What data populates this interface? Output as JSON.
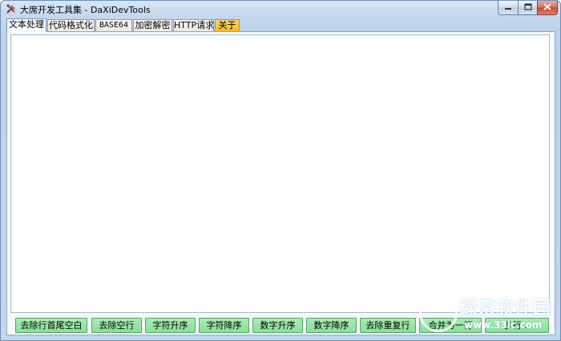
{
  "window": {
    "title": "大席开发工具集 - DaXiDevTools",
    "icon": "tools-icon",
    "controls": {
      "minimize": "minimize-icon",
      "maximize": "maximize-icon",
      "close": "close-icon"
    }
  },
  "tabs": [
    {
      "label": "文本处理",
      "active": true
    },
    {
      "label": "代码格式化",
      "active": false
    },
    {
      "label": "BASE64",
      "active": false
    },
    {
      "label": "加密解密",
      "active": false
    },
    {
      "label": "HTTP请求",
      "active": false
    },
    {
      "label": "关于",
      "active": false,
      "highlight_color": "#f4b91e"
    }
  ],
  "editor": {
    "value": ""
  },
  "actions": [
    {
      "label": "去除行首尾空白"
    },
    {
      "label": "去除空行"
    },
    {
      "label": "字符升序"
    },
    {
      "label": "字符降序"
    },
    {
      "label": "数字升序"
    },
    {
      "label": "数字降序"
    },
    {
      "label": "去除重复行"
    },
    {
      "label": "合并为一行"
    },
    {
      "label": "多行..."
    }
  ],
  "colors": {
    "button_green": "#86e196",
    "about_tab": "#f4b91e",
    "title_gradient": "#c4d7ee"
  },
  "watermark": {
    "brand": "绿茶软件园",
    "url": "www.33lc.com"
  }
}
